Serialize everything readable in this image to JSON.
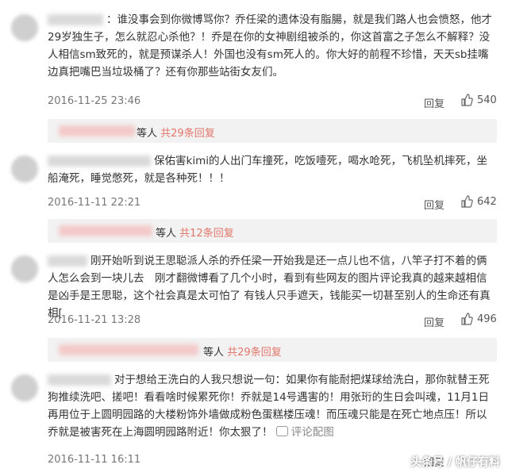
{
  "comments": [
    {
      "text": "：谁没事会到你微博骂你？乔任梁的遗体没有脂腸，就是我们路人也会愤怒，他才29岁独生子，怎么就忍心杀他？！乔是在你的女神剧组被杀的，你这首富之子怎么不解释？没人相信sm致死的，就是预谋杀人！外国也没有sm死人的。你大好的前程不珍惜，天天sb挂嘴边真把嘴巴当垃圾桶了？还有你那些站街女友们。",
      "date": "2016-11-25 23:46",
      "reply": "回复",
      "likes": "540"
    },
    {
      "text": "保佑害kimi的人出门车撞死，吃饭噎死，喝水呛死，飞机坠机摔死，坐船淹死，睡觉憋死，就是各种死！！！",
      "date": "2016-11-11 22:21",
      "reply": "回复",
      "likes": "642"
    },
    {
      "text": "刚开始听到说王思聪派人杀的乔任梁一开始我是还一点儿也不信，八竿子打不着的俩人怎么会到一块儿去　刚才翻微博看了几个小时，看到有些网友的图片评论我真的越来越相信是凶手是王思聪，这个社会真是太可怕了 有钱人只手遮天，钱能买一切甚至别人的生命还有真相[",
      "date": "2016-11-21 13:28",
      "reply": "回复",
      "likes": "496"
    },
    {
      "text": "对于想给王洗白的人我只想说一句：如果你有能耐把煤球给洗白，那你就替王死狗推续洗吧、搓吧！看看啥时候累死你！乔就是14号遇害的！用张珩的生日会叫魂，11月1日再用位于上圆明园路的大楼粉饰外墙做成粉色蛋糕楼压魂！而压魂只能是在死亡地点压！所以乔就是被害死在上海圆明园路附近！你太狠了！",
      "comment_link": "评论配图",
      "date": "2016-11-11 16:11",
      "reply": "回复"
    }
  ],
  "subs": [
    {
      "prefix": "等人",
      "count": "共29条回复"
    },
    {
      "prefix": "等人",
      "count": "共12条回复"
    },
    {
      "prefix": "等人",
      "count": "共29条回复"
    }
  ],
  "watermark": "头条号 / 帆仔有料",
  "watermark_ghost": "大头条"
}
